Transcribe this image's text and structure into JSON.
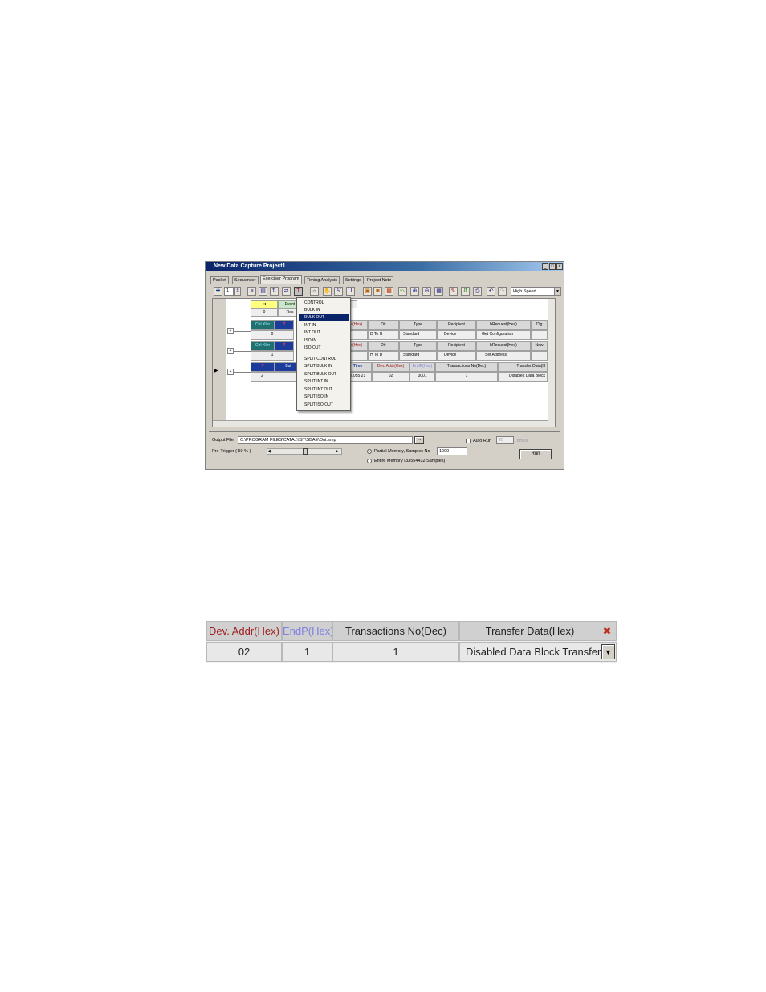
{
  "window": {
    "title": "New Data Capture Project1",
    "controls": [
      "_",
      "□",
      "×"
    ],
    "tabs": [
      "Packet",
      "Sequencer",
      "Exerciser Program",
      "Timing Analysis",
      "Settings",
      "Project Note"
    ],
    "active_tab": "Exerciser Program",
    "toolbar": {
      "stepper_value": "1",
      "speed": "High Speed"
    }
  },
  "program": {
    "event_row": {
      "label": "Event",
      "index": "0",
      "req": "Res"
    },
    "ctrl_block_1": {
      "title": "Ctrl Xfer",
      "index": "0",
      "col_c": "0",
      "headers": [
        "dr(Hex)",
        "Dir",
        "Type",
        "Recipient",
        "bRequest(Hex)",
        "Cfg"
      ],
      "values": [
        "0",
        "D To H",
        "Standard",
        "Device",
        "Get Configuration"
      ]
    },
    "ctrl_block_2": {
      "title": "Ctrl Xfer",
      "index": "1",
      "col_c": "0",
      "headers": [
        "dr(Hex)",
        "Dir",
        "Type",
        "Recipient",
        "bRequest(Hex)",
        "New"
      ],
      "values": [
        "0",
        "H To D",
        "Standard",
        "Device",
        "Set Address"
      ]
    },
    "bulk_block": {
      "title_left": "Bul",
      "index": "2",
      "headers": [
        "Time",
        "Dev. Addr(Hex)",
        "EndP(Hex)",
        "Transactions No(Dec)",
        "Transfer Data(H"
      ],
      "values": [
        "2.055 21",
        "02",
        "0001",
        "1",
        "Disabled Data Block"
      ]
    },
    "menu": {
      "items": [
        "CONTROL",
        "BULK IN",
        "BULK OUT",
        "INT IN",
        "INT OUT",
        "ISO IN",
        "ISO OUT"
      ],
      "split_items": [
        "SPLIT CONTROL",
        "SPLIT BULK IN",
        "SPLIT BULK OUT",
        "SPLIT INT IN",
        "SPLIT INT OUT",
        "SPLIT ISO IN",
        "SPLIT ISO OUT"
      ],
      "selected": "BULK OUT"
    }
  },
  "bottom": {
    "output_file_label": "Output File",
    "output_file_value": "C:\\PROGRAM FILES\\CATALYST\\SBAE\\Out.smp",
    "browse_label": "...",
    "auto_run_label": "Auto Run",
    "auto_run_value": "20",
    "times_label": "times",
    "pretrigger_label": "Pre-Trigger ( 50 % )",
    "partial_memory_label": "Partial Memory, Samples No",
    "partial_memory_value": "1000",
    "entire_memory_label": "Entire Memory (33554432 Samples)",
    "run_label": "Run"
  },
  "zoom": {
    "headers": [
      "Dev. Addr(Hex)",
      "EndP(Hex)",
      "Transactions No(Dec)",
      "Transfer Data(Hex)"
    ],
    "values": [
      "02",
      "1",
      "1",
      "Disabled Data Block Transfer"
    ]
  },
  "colors": {
    "title_blue": "#0a246a",
    "addr_red": "#a02020",
    "endp_violet": "#8080e0",
    "selected_menu": "#0a246a"
  }
}
